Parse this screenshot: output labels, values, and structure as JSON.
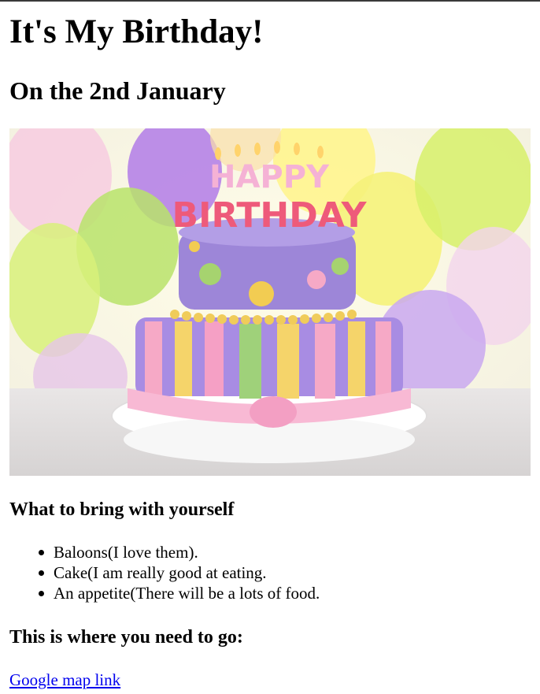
{
  "heading": "It's My Birthday!",
  "subheading": "On the 2nd January",
  "hero_image": {
    "cake_topper_line1": "HAPPY",
    "cake_topper_line2": "BIRTHDAY"
  },
  "bring_section": {
    "title": "What to bring with yourself",
    "items": [
      "Baloons(I love them).",
      "Cake(I am really good at eating.",
      "An appetite(There will be a lots of food."
    ]
  },
  "location_section": {
    "title": "This is where you need to go:",
    "link_text": "Google map link"
  },
  "colors": {
    "link": "#0000ee",
    "text": "#000000"
  }
}
